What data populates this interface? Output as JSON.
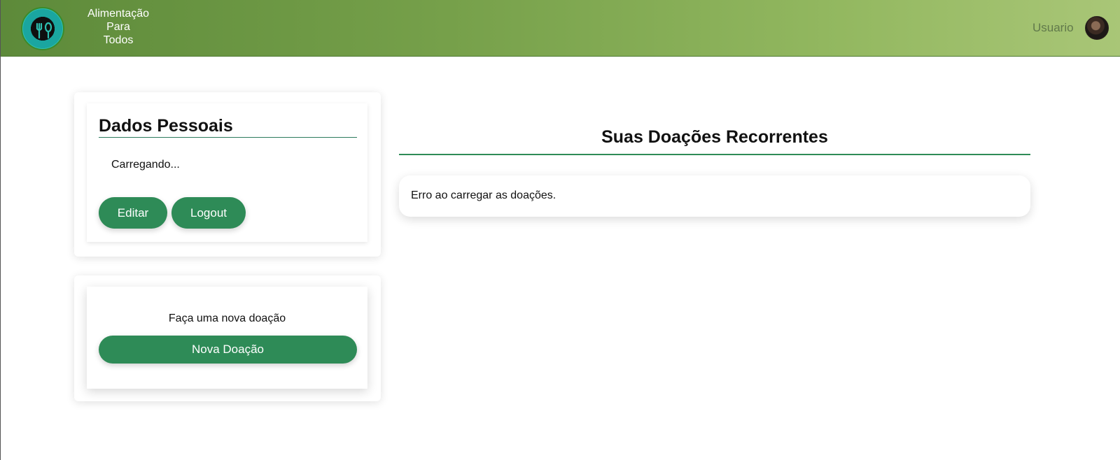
{
  "header": {
    "logo_alt": "Alimentação Para Todos Nutritech logo",
    "brand_lines": [
      "Alimentação",
      "Para",
      "Todos"
    ],
    "user_label": "Usuario"
  },
  "personal_card": {
    "title": "Dados Pessoais",
    "status_text": "Carregando...",
    "edit_label": "Editar",
    "logout_label": "Logout"
  },
  "donation_card": {
    "prompt": "Faça uma nova doação",
    "button_label": "Nova Doação"
  },
  "recurring": {
    "title": "Suas Doações Recorrentes",
    "error_message": "Erro ao carregar as doações."
  },
  "colors": {
    "header_gradient_start": "#5d8a3a",
    "header_gradient_end": "#a9c677",
    "accent_green": "#2e8b57"
  }
}
